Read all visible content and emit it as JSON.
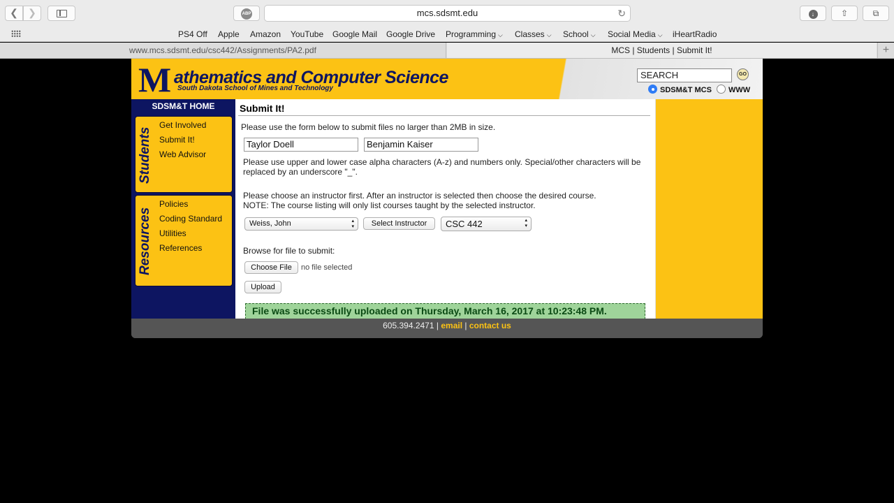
{
  "browser": {
    "url": "mcs.sdsmt.edu",
    "abp_label": "ABP",
    "bookmarks": [
      {
        "label": "PS4 Off",
        "menu": false
      },
      {
        "label": "Apple",
        "menu": false
      },
      {
        "label": "Amazon",
        "menu": false
      },
      {
        "label": "YouTube",
        "menu": false
      },
      {
        "label": "Google Mail",
        "menu": false
      },
      {
        "label": "Google Drive",
        "menu": false
      },
      {
        "label": "Programming",
        "menu": true
      },
      {
        "label": "Classes",
        "menu": true
      },
      {
        "label": "School",
        "menu": true
      },
      {
        "label": "Social Media",
        "menu": true
      },
      {
        "label": "iHeartRadio",
        "menu": false
      }
    ],
    "tabs": [
      {
        "title": "www.mcs.sdsmt.edu/csc442/Assignments/PA2.pdf",
        "active": false
      },
      {
        "title": "MCS | Students | Submit It!",
        "active": true
      }
    ]
  },
  "site": {
    "logo_m": "M",
    "logo_title": "athematics and Computer Science",
    "logo_subtitle": "South Dakota School of Mines and Technology",
    "search_value": "SEARCH",
    "go_label": "GO",
    "scope_options": [
      {
        "label": "SDSM&T MCS",
        "selected": true
      },
      {
        "label": "WWW",
        "selected": false
      }
    ],
    "nav": {
      "home": "SDSM&T HOME",
      "students_title": "Students",
      "students_links": [
        "Get Involved",
        "Submit It!",
        "Web Advisor"
      ],
      "resources_title": "Resources",
      "resources_links": [
        "Policies",
        "Coding Standard",
        "Utilities",
        "References"
      ]
    },
    "content": {
      "title": "Submit It!",
      "intro": "Please use the form below to submit files no larger than 2MB in size.",
      "name1": "Taylor Doell",
      "name2": "Benjamin Kaiser",
      "chars_note": "Please use upper and lower case alpha characters (A-z) and numbers only. Special/other characters will be replaced by an underscore \"_\".",
      "instructor_note_1": "Please choose an instructor first. After an instructor is selected then choose the desired course.",
      "instructor_note_2": "NOTE: The course listing will only list courses taught by the selected instructor.",
      "instructor_value": "Weiss, John",
      "select_instructor_label": "Select Instructor",
      "course_value": "CSC 442",
      "browse_label": "Browse for file to submit:",
      "choose_file_label": "Choose File",
      "no_file_label": "no file selected",
      "upload_label": "Upload",
      "success_message": "File was successfully uploaded on Thursday, March 16, 2017 at 10:23:48 PM."
    },
    "footer": {
      "phone": "605.394.2471",
      "sep": "|",
      "email_label": "email",
      "contact_label": "contact us"
    }
  },
  "colors": {
    "brand_gold": "#fcc214",
    "brand_navy": "#0d1561",
    "success_bg": "#9fd49a"
  }
}
